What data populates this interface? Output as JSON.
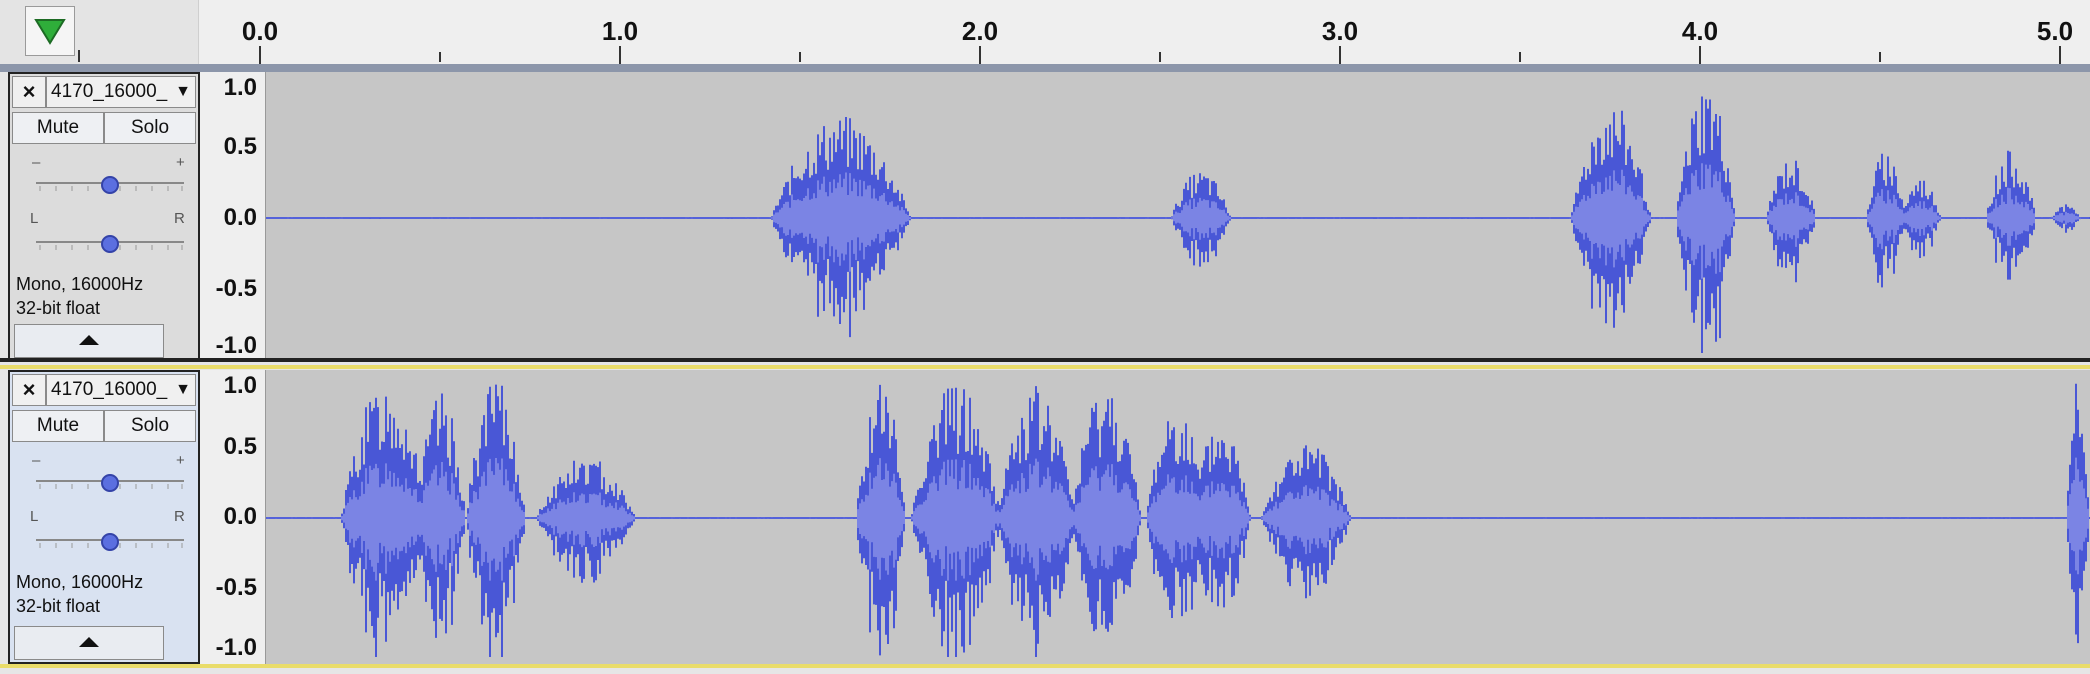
{
  "toolbar": {
    "play_icon": "green-triangle-down-icon"
  },
  "ruler": {
    "labels": [
      "0.0",
      "1.0",
      "2.0",
      "3.0",
      "4.0",
      "5.0"
    ]
  },
  "tracks": [
    {
      "name": "4170_16000_",
      "close_label": "×",
      "mute_label": "Mute",
      "solo_label": "Solo",
      "gain_minus": "–",
      "gain_plus": "+",
      "pan_left": "L",
      "pan_right": "R",
      "info_line1": "Mono, 16000Hz",
      "info_line2": "32-bit float",
      "gain_level": 0.5,
      "pan_level": 0.5,
      "scale": [
        "1.0",
        "0.5",
        "0.0",
        "-0.5",
        "-1.0"
      ],
      "selected": false
    },
    {
      "name": "4170_16000_",
      "close_label": "×",
      "mute_label": "Mute",
      "solo_label": "Solo",
      "gain_minus": "–",
      "gain_plus": "+",
      "pan_left": "L",
      "pan_right": "R",
      "info_line1": "Mono, 16000Hz",
      "info_line2": "32-bit float",
      "gain_level": 0.5,
      "pan_level": 0.5,
      "scale": [
        "1.0",
        "0.5",
        "0.0",
        "-0.5",
        "-1.0"
      ],
      "selected": true
    }
  ],
  "colors": {
    "wave_dark": "#4957d6",
    "wave_light": "#7b84e4",
    "wave_bg": "#c6c6c6",
    "play_green": "#2fae3a"
  }
}
